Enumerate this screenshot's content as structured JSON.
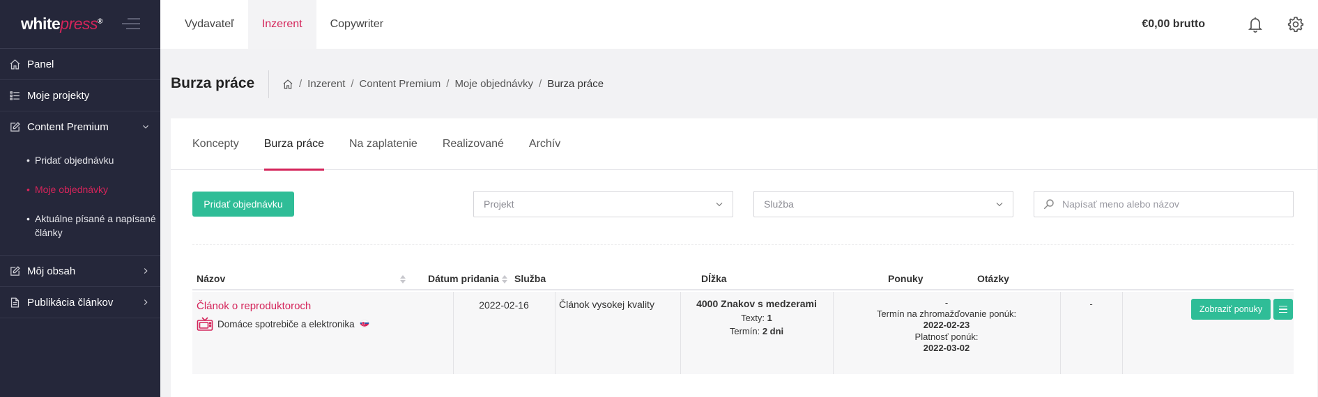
{
  "sidebar": {
    "logo_white": "white",
    "logo_press": "press",
    "logo_reg": "®",
    "items": [
      {
        "label": "Panel",
        "icon": "home-icon"
      },
      {
        "label": "Moje projekty",
        "icon": "list-icon"
      },
      {
        "label": "Content Premium",
        "icon": "edit-icon"
      },
      {
        "label": "Môj obsah",
        "icon": "edit-icon"
      },
      {
        "label": "Publikácia článkov",
        "icon": "document-icon"
      }
    ],
    "sub_items": [
      {
        "label": "Pridať objednávku"
      },
      {
        "label": "Moje objednávky"
      },
      {
        "label": "Aktuálne písané a napísané články"
      }
    ]
  },
  "topbar": {
    "nav": [
      "Vydavateľ",
      "Inzerent",
      "Copywriter"
    ],
    "active_nav": "Inzerent",
    "balance": "€0,00 brutto"
  },
  "header": {
    "title": "Burza práce",
    "breadcrumb": [
      "Inzerent",
      "Content Premium",
      "Moje objednávky",
      "Burza práce"
    ]
  },
  "tabs": [
    "Koncepty",
    "Burza práce",
    "Na zaplatenie",
    "Realizované",
    "Archív"
  ],
  "active_tab": "Burza práce",
  "toolbar": {
    "add_label": "Pridať objednávku",
    "project_placeholder": "Projekt",
    "service_placeholder": "Služba",
    "search_placeholder": "Napísať meno alebo názov"
  },
  "table": {
    "columns": [
      "Názov",
      "Dátum pridania",
      "Služba",
      "Dĺžka",
      "Ponuky",
      "Otázky"
    ],
    "rows": [
      {
        "title": "Článok o reproduktoroch",
        "category": "Domáce spotrebiče a elektronika",
        "date": "2022-02-16",
        "service": "Článok vysokej kvality",
        "length_title": "4000 Znakov s medzerami",
        "texts_label": "Texty:",
        "texts_value": "1",
        "term_label": "Termín:",
        "term_value": "2 dni",
        "offers": "-",
        "collect_label": "Termín na zhromažďovanie ponúk:",
        "collect_date": "2022-02-23",
        "validity_label": "Platnosť ponúk:",
        "validity_date": "2022-03-02",
        "questions": "-",
        "show_offers_label": "Zobraziť ponuky"
      }
    ]
  },
  "colors": {
    "accent": "#d4245a",
    "green": "#2fbd97",
    "sidebar_bg": "#25273a"
  }
}
